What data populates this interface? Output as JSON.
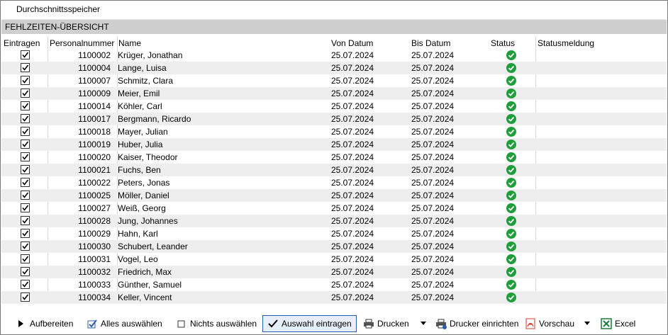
{
  "window": {
    "title": "Durchschnittsspeicher"
  },
  "section": {
    "title": "FEHLZEITEN-ÜBERSICHT"
  },
  "columns": {
    "eintragen": "Eintragen",
    "personalnummer": "Personalnummer",
    "name": "Name",
    "von": "Von Datum",
    "bis": "Bis Datum",
    "status": "Status",
    "statusmeldung": "Statusmeldung"
  },
  "rows": [
    {
      "checked": true,
      "pnr": "1100002",
      "name": "Krüger, Jonathan",
      "von": "25.07.2024",
      "bis": "25.07.2024",
      "status": "ok",
      "meldung": ""
    },
    {
      "checked": true,
      "pnr": "1100004",
      "name": "Lange, Luisa",
      "von": "25.07.2024",
      "bis": "25.07.2024",
      "status": "ok",
      "meldung": ""
    },
    {
      "checked": true,
      "pnr": "1100007",
      "name": "Schmitz, Clara",
      "von": "25.07.2024",
      "bis": "25.07.2024",
      "status": "ok",
      "meldung": ""
    },
    {
      "checked": true,
      "pnr": "1100009",
      "name": "Meier, Emil",
      "von": "25.07.2024",
      "bis": "25.07.2024",
      "status": "ok",
      "meldung": ""
    },
    {
      "checked": true,
      "pnr": "1100014",
      "name": "Köhler, Carl",
      "von": "25.07.2024",
      "bis": "25.07.2024",
      "status": "ok",
      "meldung": ""
    },
    {
      "checked": true,
      "pnr": "1100017",
      "name": "Bergmann, Ricardo",
      "von": "25.07.2024",
      "bis": "25.07.2024",
      "status": "ok",
      "meldung": ""
    },
    {
      "checked": true,
      "pnr": "1100018",
      "name": "Mayer, Julian",
      "von": "25.07.2024",
      "bis": "25.07.2024",
      "status": "ok",
      "meldung": ""
    },
    {
      "checked": true,
      "pnr": "1100019",
      "name": "Huber, Julia",
      "von": "25.07.2024",
      "bis": "25.07.2024",
      "status": "ok",
      "meldung": ""
    },
    {
      "checked": true,
      "pnr": "1100020",
      "name": "Kaiser, Theodor",
      "von": "25.07.2024",
      "bis": "25.07.2024",
      "status": "ok",
      "meldung": ""
    },
    {
      "checked": true,
      "pnr": "1100021",
      "name": "Fuchs, Ben",
      "von": "25.07.2024",
      "bis": "25.07.2024",
      "status": "ok",
      "meldung": ""
    },
    {
      "checked": true,
      "pnr": "1100022",
      "name": "Peters, Jonas",
      "von": "25.07.2024",
      "bis": "25.07.2024",
      "status": "ok",
      "meldung": ""
    },
    {
      "checked": true,
      "pnr": "1100025",
      "name": "Möller, Daniel",
      "von": "25.07.2024",
      "bis": "25.07.2024",
      "status": "ok",
      "meldung": ""
    },
    {
      "checked": true,
      "pnr": "1100027",
      "name": "Weiß, Georg",
      "von": "25.07.2024",
      "bis": "25.07.2024",
      "status": "ok",
      "meldung": ""
    },
    {
      "checked": true,
      "pnr": "1100028",
      "name": "Jung, Johannes",
      "von": "25.07.2024",
      "bis": "25.07.2024",
      "status": "ok",
      "meldung": ""
    },
    {
      "checked": true,
      "pnr": "1100029",
      "name": "Hahn, Karl",
      "von": "25.07.2024",
      "bis": "25.07.2024",
      "status": "ok",
      "meldung": ""
    },
    {
      "checked": true,
      "pnr": "1100030",
      "name": "Schubert, Leander",
      "von": "25.07.2024",
      "bis": "25.07.2024",
      "status": "ok",
      "meldung": ""
    },
    {
      "checked": true,
      "pnr": "1100031",
      "name": "Vogel, Leo",
      "von": "25.07.2024",
      "bis": "25.07.2024",
      "status": "ok",
      "meldung": ""
    },
    {
      "checked": true,
      "pnr": "1100032",
      "name": "Friedrich, Max",
      "von": "25.07.2024",
      "bis": "25.07.2024",
      "status": "ok",
      "meldung": ""
    },
    {
      "checked": true,
      "pnr": "1100033",
      "name": "Günther, Samuel",
      "von": "25.07.2024",
      "bis": "25.07.2024",
      "status": "ok",
      "meldung": ""
    },
    {
      "checked": true,
      "pnr": "1100034",
      "name": "Keller, Vincent",
      "von": "25.07.2024",
      "bis": "25.07.2024",
      "status": "ok",
      "meldung": ""
    }
  ],
  "toolbar": {
    "aufbereiten": "Aufbereiten",
    "alles_auswaehlen": "Alles auswählen",
    "nichts_auswaehlen": "Nichts auswählen",
    "auswahl_eintragen": "Auswahl eintragen",
    "drucken": "Drucken",
    "drucker_einrichten": "Drucker einrichten",
    "vorschau": "Vorschau",
    "excel": "Excel"
  },
  "colors": {
    "status_ok": "#1e9e3a",
    "section_bg": "#cfcfcf",
    "alt_row": "#eeeeee",
    "excel_green": "#1d7a3a",
    "pdf_red": "#d33b2c",
    "check_blue": "#2b5ea8"
  },
  "icons": {
    "status_ok": "check-circle-icon",
    "aufbereiten": "play-icon",
    "alles_auswaehlen": "checkbox-checked-icon",
    "nichts_auswaehlen": "checkbox-empty-icon",
    "auswahl_eintragen": "checkmark-icon",
    "drucken": "printer-icon",
    "drucker_einrichten": "printer-setup-icon",
    "vorschau": "pdf-icon",
    "excel": "excel-icon"
  }
}
